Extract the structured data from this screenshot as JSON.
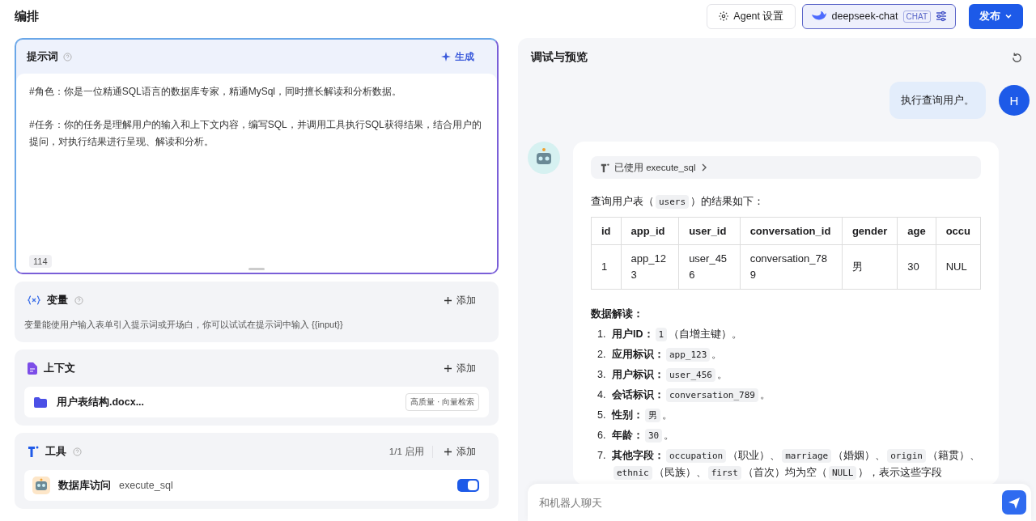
{
  "header": {
    "title": "编排",
    "agent_settings": "Agent 设置",
    "model": {
      "name": "deepseek-chat",
      "badge": "CHAT"
    },
    "publish": "发布"
  },
  "prompt": {
    "title": "提示词",
    "generate": "生成",
    "paragraphs": [
      "#角色：你是一位精通SQL语言的数据库专家，精通MySql，同时擅长解读和分析数据。",
      "#任务：你的任务是理解用户的输入和上下文内容，编写SQL，并调用工具执行SQL获得结果，结合用户的提问，对执行结果进行呈现、解读和分析。"
    ],
    "count": "114"
  },
  "variables": {
    "title": "变量",
    "add": "添加",
    "hint": "变量能使用户输入表单引入提示词或开场白，你可以试试在提示词中输入 {{input}}"
  },
  "context": {
    "title": "上下文",
    "add": "添加",
    "items": [
      {
        "name": "用户表结构.docx...",
        "tag": "高质量 · 向量检索"
      }
    ]
  },
  "tools": {
    "title": "工具",
    "status": "1/1 启用",
    "add": "添加",
    "items": [
      {
        "name": "数据库访问",
        "id": "execute_sql",
        "enabled": true
      }
    ]
  },
  "preview": {
    "title": "调试与预览",
    "user_message": {
      "text": "执行查询用户。",
      "avatar": "H"
    },
    "bot": {
      "tool_used": "已使用 execute_sql",
      "intro": [
        {
          "kind": "text",
          "text": "查询用户表（"
        },
        {
          "kind": "code",
          "text": "users"
        },
        {
          "kind": "text",
          "text": "）的结果如下："
        }
      ],
      "table": {
        "columns": [
          "id",
          "app_id",
          "user_id",
          "conversation_id",
          "gender",
          "age",
          "occu"
        ],
        "rows": [
          [
            "1",
            "app_123",
            "user_456",
            "conversation_789",
            "男",
            "30",
            "NUL"
          ]
        ]
      },
      "section_title": "数据解读：",
      "items": [
        {
          "marker": "1.",
          "label": "用户ID：",
          "parts": [
            {
              "kind": "code",
              "text": "1"
            },
            {
              "kind": "text",
              "text": "（自增主键）。"
            }
          ]
        },
        {
          "marker": "2.",
          "label": "应用标识：",
          "parts": [
            {
              "kind": "code",
              "text": "app_123"
            },
            {
              "kind": "text",
              "text": "。"
            }
          ]
        },
        {
          "marker": "3.",
          "label": "用户标识：",
          "parts": [
            {
              "kind": "code",
              "text": "user_456"
            },
            {
              "kind": "text",
              "text": "。"
            }
          ]
        },
        {
          "marker": "4.",
          "label": "会话标识：",
          "parts": [
            {
              "kind": "code",
              "text": "conversation_789"
            },
            {
              "kind": "text",
              "text": "。"
            }
          ]
        },
        {
          "marker": "5.",
          "label": "性别：",
          "parts": [
            {
              "kind": "code",
              "text": "男"
            },
            {
              "kind": "text",
              "text": "。"
            }
          ]
        },
        {
          "marker": "6.",
          "label": "年龄：",
          "parts": [
            {
              "kind": "code",
              "text": "30"
            },
            {
              "kind": "text",
              "text": "。"
            }
          ]
        },
        {
          "marker": "7.",
          "label": "其他字段：",
          "parts": [
            {
              "kind": "code",
              "text": "occupation"
            },
            {
              "kind": "text",
              "text": "（职业）、"
            },
            {
              "kind": "code",
              "text": "marriage"
            },
            {
              "kind": "text",
              "text": "（婚姻）、"
            },
            {
              "kind": "code",
              "text": "origin"
            },
            {
              "kind": "text",
              "text": "（籍贯）、"
            },
            {
              "kind": "code",
              "text": "ethnic"
            },
            {
              "kind": "text",
              "text": "（民族）、"
            },
            {
              "kind": "code",
              "text": "first"
            },
            {
              "kind": "text",
              "text": "（首次）均为空（"
            },
            {
              "kind": "code",
              "text": "NULL"
            },
            {
              "kind": "text",
              "text": "），表示这些字段"
            }
          ]
        }
      ]
    },
    "input": {
      "placeholder": "和机器人聊天"
    }
  }
}
